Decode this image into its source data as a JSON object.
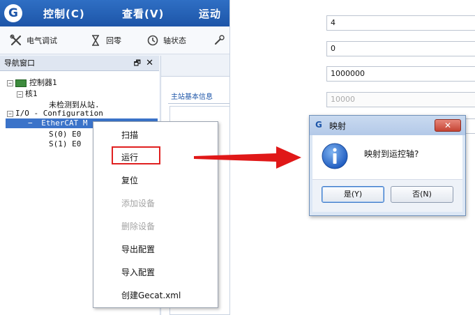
{
  "app": {
    "logo": "G",
    "menus": [
      "控制(C)",
      "查看(V)",
      "运动"
    ],
    "toolbar": {
      "electrical_debug": "电气调试",
      "homing": "回零",
      "axis_status": "轴状态"
    }
  },
  "nav": {
    "title": "导航窗口",
    "pin": "🗗",
    "close": "✕",
    "tree": {
      "controller": "控制器1",
      "core": "核1",
      "no_slave": "未检测到从站.",
      "io_config": "I/O - Configuration",
      "ethercat": "EtherCAT M",
      "slave0": "S(0) E0",
      "slave1": "S(1) E0"
    }
  },
  "right_pane": {
    "tab": "主站基本信息"
  },
  "context_menu": {
    "items": [
      "扫描",
      "运行",
      "复位",
      "添加设备",
      "删除设备",
      "导出配置",
      "导入配置",
      "创建Gecat.xml"
    ]
  },
  "properties": {
    "fields": [
      "4",
      "0",
      "1000000",
      "10000"
    ]
  },
  "dialog": {
    "icon": "G",
    "title": "映射",
    "message": "映射到运控轴?",
    "yes": "是(Y)",
    "no": "否(N)"
  },
  "colors": {
    "menubar": "#1d55a8",
    "selection": "#3b73c9",
    "highlight_box": "#e02020",
    "arrow": "#e01818"
  }
}
